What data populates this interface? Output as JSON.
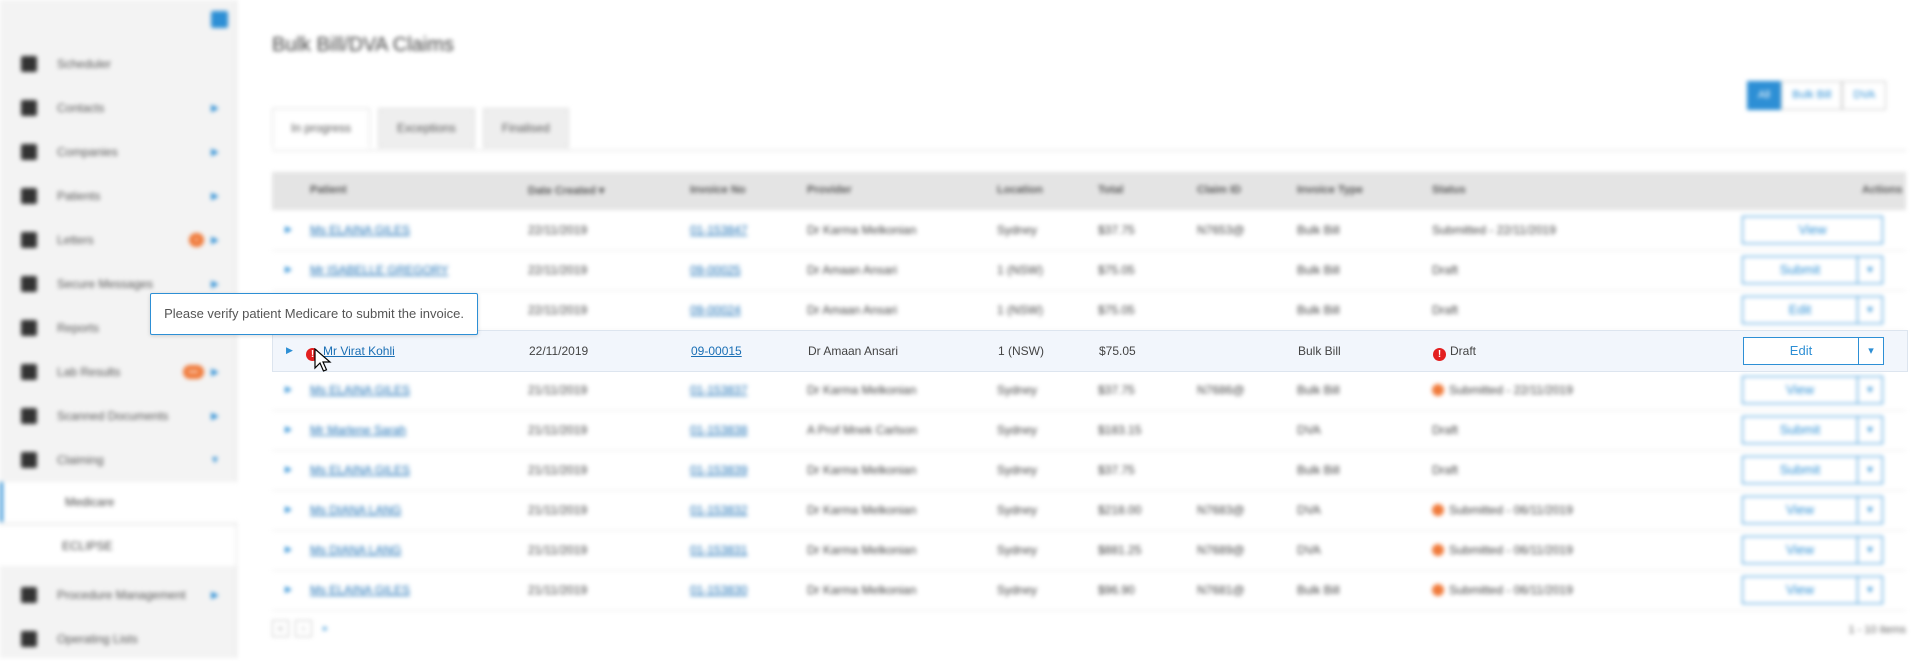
{
  "sidebar": {
    "items": [
      {
        "label": "Scheduler"
      },
      {
        "label": "Contacts"
      },
      {
        "label": "Companies"
      },
      {
        "label": "Patients"
      },
      {
        "label": "Letters",
        "badge": "•"
      },
      {
        "label": "Secure Messages"
      },
      {
        "label": "Reports"
      },
      {
        "label": "Lab Results",
        "badge": "•••"
      },
      {
        "label": "Scanned Documents"
      },
      {
        "label": "Claiming"
      }
    ],
    "sub_items": [
      {
        "label": "Medicare"
      },
      {
        "label": "ECLIPSE"
      }
    ],
    "bottom_items": [
      {
        "label": "Procedure Management"
      },
      {
        "label": "Operating Lists"
      }
    ]
  },
  "page": {
    "title": "Bulk Bill/DVA Claims",
    "filter_segments": [
      "All",
      "Bulk Bill",
      "DVA"
    ],
    "tabs": [
      "In progress",
      "Exceptions",
      "Finalised"
    ],
    "columns": [
      "Patient",
      "Date Created ▾",
      "Invoice No",
      "Provider",
      "Location",
      "Total",
      "Claim ID",
      "Invoice Type",
      "Status",
      "Actions"
    ]
  },
  "rows": [
    {
      "patient": "Ms ELAINA GILES",
      "date": "22/11/2019",
      "invoice": "01-153847",
      "provider": "Dr Karma Melkonian",
      "location": "Sydney",
      "total": "$37.75",
      "claim": "N7653@",
      "type": "Bulk Bill",
      "status": "Submitted - 22/11/2019",
      "action": "View"
    },
    {
      "patient": "Mr ISABELLE GREGORY",
      "date": "22/11/2019",
      "invoice": "09-00025",
      "provider": "Dr Amaan Ansari",
      "location": "1 (NSW)",
      "total": "$75.05",
      "claim": "",
      "type": "Bulk Bill",
      "status": "Draft",
      "action": "Submit"
    },
    {
      "patient": "",
      "date": "22/11/2019",
      "invoice": "09-00024",
      "provider": "Dr Amaan Ansari",
      "location": "1 (NSW)",
      "total": "$75.05",
      "claim": "",
      "type": "Bulk Bill",
      "status": "Draft",
      "action": "Edit"
    },
    {
      "patient": "Mr Virat Kohli",
      "date": "22/11/2019",
      "invoice": "09-00015",
      "provider": "Dr Amaan Ansari",
      "location": "1 (NSW)",
      "total": "$75.05",
      "claim": "",
      "type": "Bulk Bill",
      "status": "Draft",
      "action": "Edit"
    },
    {
      "patient": "Ms ELAINA GILES",
      "date": "21/11/2019",
      "invoice": "01-153837",
      "provider": "Dr Karma Melkonian",
      "location": "Sydney",
      "total": "$37.75",
      "claim": "N7686@",
      "type": "Bulk Bill",
      "status": "Submitted - 22/11/2019",
      "action": "View"
    },
    {
      "patient": "Mr Marlene Sarah",
      "date": "21/11/2019",
      "invoice": "01-153838",
      "provider": "A Prof Mnek Carlson",
      "location": "Sydney",
      "total": "$183.15",
      "claim": "",
      "type": "DVA",
      "status": "Draft",
      "action": "Submit"
    },
    {
      "patient": "Ms ELAINA GILES",
      "date": "21/11/2019",
      "invoice": "01-153839",
      "provider": "Dr Karma Melkonian",
      "location": "Sydney",
      "total": "$37.75",
      "claim": "",
      "type": "Bulk Bill",
      "status": "Draft",
      "action": "Submit"
    },
    {
      "patient": "Ms DIANA LANG",
      "date": "21/11/2019",
      "invoice": "01-153832",
      "provider": "Dr Karma Melkonian",
      "location": "Sydney",
      "total": "$218.00",
      "claim": "N7683@",
      "type": "DVA",
      "status": "Submitted - 06/11/2019",
      "action": "View"
    },
    {
      "patient": "Ms DIANA LANG",
      "date": "21/11/2019",
      "invoice": "01-153831",
      "provider": "Dr Karma Melkonian",
      "location": "Sydney",
      "total": "$881.25",
      "claim": "N7689@",
      "type": "DVA",
      "status": "Submitted - 06/11/2019",
      "action": "View"
    },
    {
      "patient": "Ms ELAINA GILES",
      "date": "21/11/2019",
      "invoice": "01-153830",
      "provider": "Dr Karma Melkonian",
      "location": "Sydney",
      "total": "$96.90",
      "claim": "N7681@",
      "type": "Bulk Bill",
      "status": "Submitted - 06/11/2019",
      "action": "View"
    }
  ],
  "pagination": {
    "range": "1 - 10 items"
  },
  "tooltip": {
    "text": "Please verify patient Medicare to submit the invoice."
  },
  "colors": {
    "accent": "#2d8fd5",
    "error": "#e32020",
    "warning": "#f07a3a"
  }
}
